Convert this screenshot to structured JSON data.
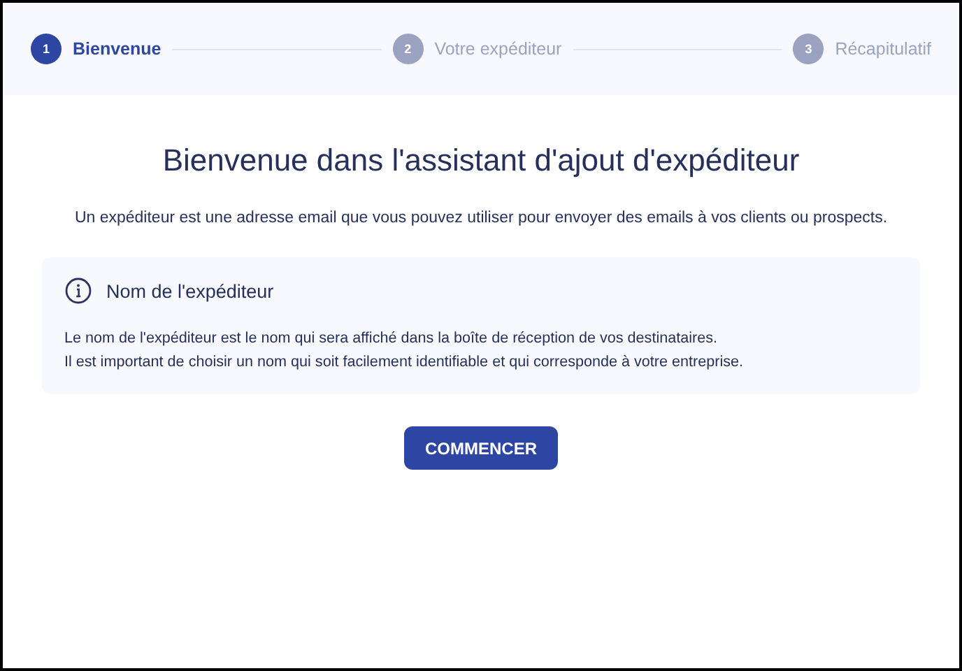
{
  "steps": [
    {
      "number": "1",
      "label": "Bienvenue",
      "selected": true
    },
    {
      "number": "2",
      "label": "Votre expéditeur",
      "selected": false
    },
    {
      "number": "3",
      "label": "Récapitulatif",
      "selected": false
    }
  ],
  "title": "Bienvenue dans l'assistant d'ajout d'expéditeur",
  "intro": "Un expéditeur est une adresse email que vous pouvez utiliser pour envoyer des emails à vos clients ou prospects.",
  "info_card": {
    "title": "Nom de l'expéditeur",
    "paragraphs": [
      "Le nom de l'expéditeur est le nom qui sera affiché dans la boîte de réception de vos destinataires.",
      "Il est important de choisir un nom qui soit facilement identifiable et qui corresponde à votre entreprise."
    ]
  },
  "button": "COMMENCER"
}
